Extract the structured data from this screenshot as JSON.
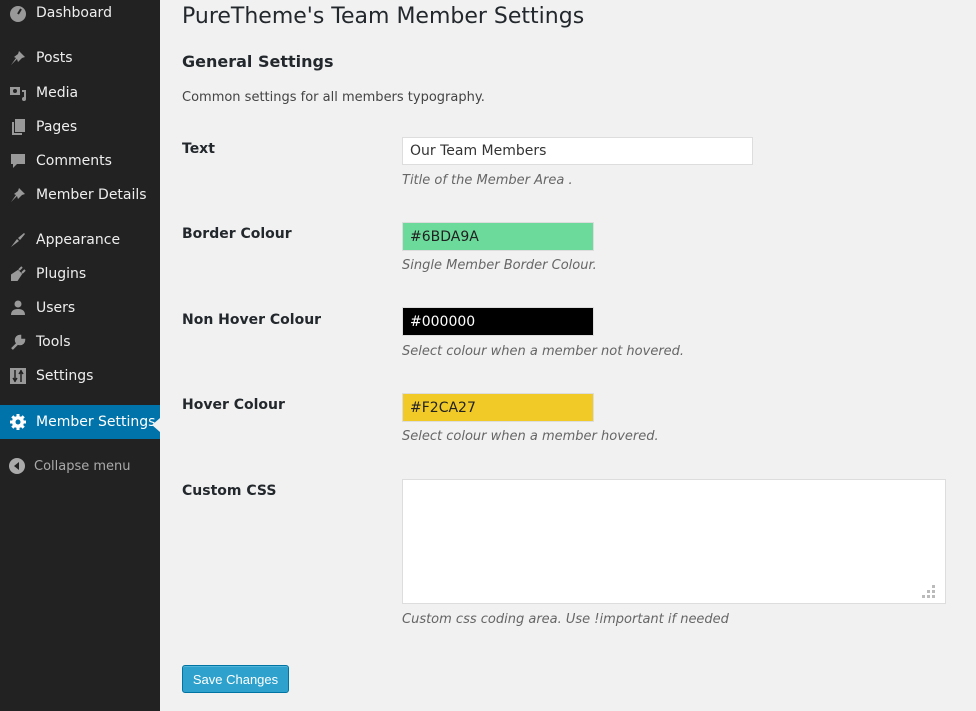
{
  "sidebar": {
    "items": [
      {
        "label": "Dashboard",
        "icon": "dashboard-icon"
      },
      {
        "label": "Posts",
        "icon": "pin-icon"
      },
      {
        "label": "Media",
        "icon": "media-icon"
      },
      {
        "label": "Pages",
        "icon": "pages-icon"
      },
      {
        "label": "Comments",
        "icon": "comment-icon"
      },
      {
        "label": "Member Details",
        "icon": "pin-icon"
      },
      {
        "label": "Appearance",
        "icon": "brush-icon"
      },
      {
        "label": "Plugins",
        "icon": "plug-icon"
      },
      {
        "label": "Users",
        "icon": "user-icon"
      },
      {
        "label": "Tools",
        "icon": "wrench-icon"
      },
      {
        "label": "Settings",
        "icon": "sliders-icon"
      },
      {
        "label": "Member Settings",
        "icon": "gear-icon",
        "active": true
      }
    ],
    "collapse_label": "Collapse menu"
  },
  "page": {
    "title": "PureTheme's Team Member Settings",
    "section_title": "General Settings",
    "section_desc": "Common settings for all members typography."
  },
  "fields": {
    "text": {
      "label": "Text",
      "value": "Our Team Members",
      "desc": "Title of the Member Area ."
    },
    "border_colour": {
      "label": "Border Colour",
      "value": "#6BDA9A",
      "desc": "Single Member Border Colour."
    },
    "non_hover_colour": {
      "label": "Non Hover Colour",
      "value": "#000000",
      "desc": "Select colour when a member not hovered."
    },
    "hover_colour": {
      "label": "Hover Colour",
      "value": "#F2CA27",
      "desc": "Select colour when a member hovered."
    },
    "custom_css": {
      "label": "Custom CSS",
      "value": "",
      "desc": "Custom css coding area. Use !important if needed"
    }
  },
  "actions": {
    "save_label": "Save Changes"
  },
  "colors": {
    "accent": "#0073aa",
    "button": "#2ea2cc",
    "sidebar_bg": "#222222"
  }
}
